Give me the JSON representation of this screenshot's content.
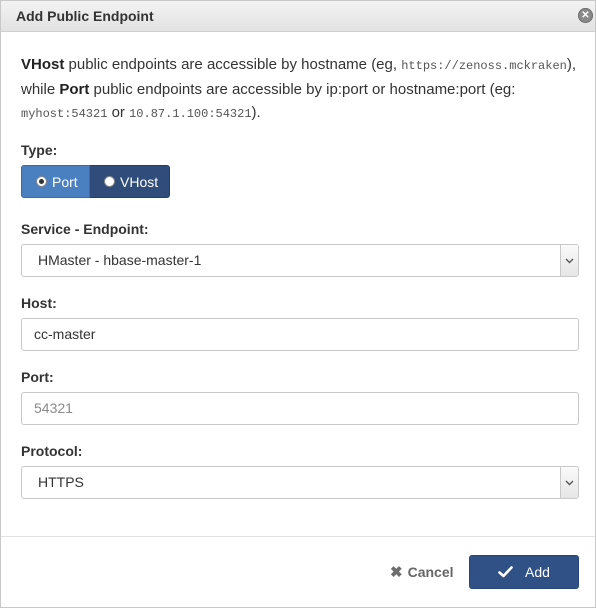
{
  "dialog": {
    "title": "Add Public Endpoint",
    "close_icon": "close-icon"
  },
  "intro": {
    "vhost_word": "VHost",
    "text1": " public endpoints are accessible by hostname (eg, ",
    "vhost_example": "https://zenoss.mckraken",
    "text2": "), while ",
    "port_word": "Port",
    "text3": " public endpoints are accessible by ip:port or hostname:port (eg: ",
    "port_example1": "myhost:54321",
    "text4": " or ",
    "port_example2": "10.87.1.100:54321",
    "text5": ")."
  },
  "type": {
    "label": "Type:",
    "options": [
      "Port",
      "VHost"
    ],
    "selected": "Port"
  },
  "service_endpoint": {
    "label": "Service - Endpoint:",
    "value": "HMaster - hbase-master-1"
  },
  "host": {
    "label": "Host:",
    "value": "cc-master"
  },
  "port": {
    "label": "Port:",
    "placeholder": "54321"
  },
  "protocol": {
    "label": "Protocol:",
    "value": "HTTPS"
  },
  "footer": {
    "cancel_label": "Cancel",
    "add_label": "Add"
  },
  "colors": {
    "primary": "#2f5185",
    "active_segment": "#4a7fc0",
    "inactive_segment": "#2f4c7a"
  }
}
